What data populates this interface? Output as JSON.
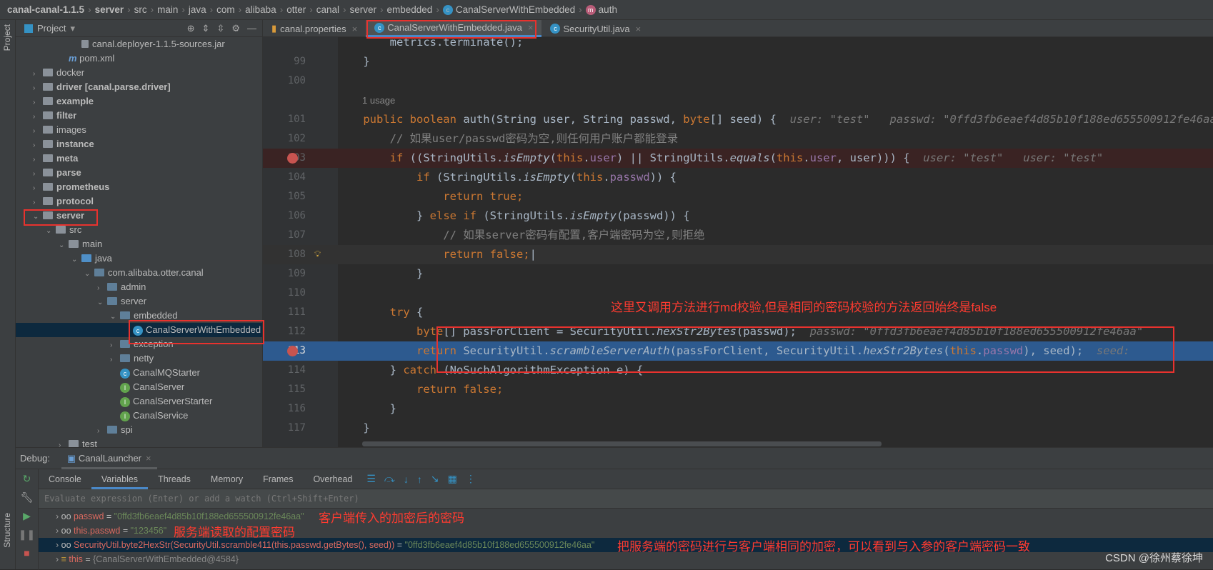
{
  "breadcrumb": [
    {
      "label": "canal-canal-1.1.5",
      "bold": true
    },
    {
      "label": "server",
      "bold": true
    },
    {
      "label": "src"
    },
    {
      "label": "main"
    },
    {
      "label": "java"
    },
    {
      "label": "com"
    },
    {
      "label": "alibaba"
    },
    {
      "label": "otter"
    },
    {
      "label": "canal"
    },
    {
      "label": "server"
    },
    {
      "label": "embedded"
    },
    {
      "label": "CanalServerWithEmbedded",
      "icon": "c"
    },
    {
      "label": "auth",
      "icon": "m"
    }
  ],
  "left_strip": {
    "project": "Project",
    "structure": "Structure"
  },
  "project_panel": {
    "title": "Project",
    "tree": [
      {
        "label": "canal.deployer-1.1.5-sources.jar",
        "depth": 4,
        "kind": "jar",
        "sel": false
      },
      {
        "label": "pom.xml",
        "depth": 3,
        "kind": "maven"
      },
      {
        "label": "docker",
        "depth": 1,
        "kind": "folder",
        "arrow": "›"
      },
      {
        "label": "driver [canal.parse.driver]",
        "depth": 1,
        "kind": "folder",
        "arrow": "›",
        "bold": true
      },
      {
        "label": "example",
        "depth": 1,
        "kind": "folder",
        "arrow": "›",
        "bold": true
      },
      {
        "label": "filter",
        "depth": 1,
        "kind": "folder",
        "arrow": "›",
        "bold": true
      },
      {
        "label": "images",
        "depth": 1,
        "kind": "folder",
        "arrow": "›"
      },
      {
        "label": "instance",
        "depth": 1,
        "kind": "folder",
        "arrow": "›",
        "bold": true
      },
      {
        "label": "meta",
        "depth": 1,
        "kind": "folder",
        "arrow": "›",
        "bold": true
      },
      {
        "label": "parse",
        "depth": 1,
        "kind": "folder",
        "arrow": "›",
        "bold": true
      },
      {
        "label": "prometheus",
        "depth": 1,
        "kind": "folder",
        "arrow": "›",
        "bold": true
      },
      {
        "label": "protocol",
        "depth": 1,
        "kind": "folder",
        "arrow": "›",
        "bold": true
      },
      {
        "label": "server",
        "depth": 1,
        "kind": "folder",
        "arrow": "⌄",
        "bold": true
      },
      {
        "label": "src",
        "depth": 2,
        "kind": "folder",
        "arrow": "⌄"
      },
      {
        "label": "main",
        "depth": 3,
        "kind": "folder",
        "arrow": "⌄"
      },
      {
        "label": "java",
        "depth": 4,
        "kind": "src",
        "arrow": "⌄"
      },
      {
        "label": "com.alibaba.otter.canal",
        "depth": 5,
        "kind": "pkg",
        "arrow": "⌄"
      },
      {
        "label": "admin",
        "depth": 6,
        "kind": "pkg",
        "arrow": "›"
      },
      {
        "label": "server",
        "depth": 6,
        "kind": "pkg",
        "arrow": "⌄"
      },
      {
        "label": "embedded",
        "depth": 7,
        "kind": "pkg",
        "arrow": "⌄"
      },
      {
        "label": "CanalServerWithEmbedded",
        "depth": 8,
        "kind": "class",
        "sel": true
      },
      {
        "label": "exception",
        "depth": 7,
        "kind": "pkg",
        "arrow": "›"
      },
      {
        "label": "netty",
        "depth": 7,
        "kind": "pkg",
        "arrow": "›"
      },
      {
        "label": "CanalMQStarter",
        "depth": 7,
        "kind": "class"
      },
      {
        "label": "CanalServer",
        "depth": 7,
        "kind": "interface"
      },
      {
        "label": "CanalServerStarter",
        "depth": 7,
        "kind": "interface"
      },
      {
        "label": "CanalService",
        "depth": 7,
        "kind": "interface"
      },
      {
        "label": "spi",
        "depth": 6,
        "kind": "pkg",
        "arrow": "›"
      },
      {
        "label": "test",
        "depth": 3,
        "kind": "folder",
        "arrow": "›"
      }
    ]
  },
  "tabs": [
    {
      "label": "canal.properties",
      "icon": "properties"
    },
    {
      "label": "CanalServerWithEmbedded.java",
      "icon": "c",
      "active": true
    },
    {
      "label": "SecurityUtil.java",
      "icon": "c"
    }
  ],
  "editor": {
    "usage": "1 usage",
    "lines": [
      {
        "n": "",
        "t": [
          [
            "",
            "        metrics.terminate();"
          ]
        ]
      },
      {
        "n": "99",
        "t": [
          [
            "",
            "    }"
          ]
        ]
      },
      {
        "n": "100",
        "t": []
      },
      {
        "n": "",
        "usage": true,
        "t": []
      },
      {
        "n": "101",
        "t": [
          [
            "kw",
            "    public boolean "
          ],
          [
            "",
            "auth(String user, String passwd, "
          ],
          [
            "kw",
            "byte"
          ],
          [
            "",
            "[] seed) {  "
          ],
          [
            "hint",
            "user: \"test\"   passwd: \"0ffd3fb6eaef4d85b10f188ed655500912fe46aa\""
          ]
        ]
      },
      {
        "n": "102",
        "t": [
          [
            "cm",
            "        // 如果user/passwd密码为空,则任何用户账户都能登录"
          ]
        ]
      },
      {
        "n": "103",
        "bp": true,
        "cls": "bp",
        "t": [
          [
            "kw",
            "        if "
          ],
          [
            "",
            "((StringUtils."
          ],
          [
            "it",
            "isEmpty"
          ],
          [
            "",
            "("
          ],
          [
            "kw",
            "this"
          ],
          [
            "",
            "."
          ],
          [
            "fld",
            "user"
          ],
          [
            "",
            ") || StringUtils."
          ],
          [
            "it",
            "equals"
          ],
          [
            "",
            "("
          ],
          [
            "kw",
            "this"
          ],
          [
            "",
            "."
          ],
          [
            "fld",
            "user"
          ],
          [
            "",
            ", user))) {  "
          ],
          [
            "hint",
            "user: \"test\"   user: \"test\""
          ]
        ]
      },
      {
        "n": "104",
        "t": [
          [
            "kw",
            "            if "
          ],
          [
            "",
            "(StringUtils."
          ],
          [
            "it",
            "isEmpty"
          ],
          [
            "",
            "("
          ],
          [
            "kw",
            "this"
          ],
          [
            "",
            "."
          ],
          [
            "fld",
            "passwd"
          ],
          [
            "",
            ")) {"
          ]
        ]
      },
      {
        "n": "105",
        "t": [
          [
            "kw",
            "                return true"
          ],
          [
            "kw",
            ";"
          ]
        ]
      },
      {
        "n": "106",
        "t": [
          [
            "",
            "            } "
          ],
          [
            "kw",
            "else if "
          ],
          [
            "",
            "(StringUtils."
          ],
          [
            "it",
            "isEmpty"
          ],
          [
            "",
            "(passwd)) {"
          ]
        ]
      },
      {
        "n": "107",
        "t": [
          [
            "cm",
            "                // 如果server密码有配置,客户端密码为空,则拒绝"
          ]
        ]
      },
      {
        "n": "108",
        "cls": "cur",
        "t": [
          [
            "kw",
            "                return false"
          ],
          [
            "kw",
            ";"
          ],
          [
            "",
            "|"
          ]
        ]
      },
      {
        "n": "109",
        "t": [
          [
            "",
            "            }"
          ]
        ]
      },
      {
        "n": "110",
        "t": []
      },
      {
        "n": "111",
        "t": [
          [
            "kw",
            "        try "
          ],
          [
            "",
            "{"
          ]
        ]
      },
      {
        "n": "112",
        "t": [
          [
            "kw",
            "            byte"
          ],
          [
            "",
            "[] passForClient = SecurityUtil."
          ],
          [
            "it",
            "hexStr2Bytes"
          ],
          [
            "",
            "(passwd);  "
          ],
          [
            "hint",
            "passwd: \"0ffd3fb6eaef4d85b10f188ed655500912fe46aa\""
          ]
        ]
      },
      {
        "n": "113",
        "bp": true,
        "cls": "exec",
        "t": [
          [
            "kw",
            "            return "
          ],
          [
            "",
            "SecurityUtil."
          ],
          [
            "it",
            "scrambleServerAuth"
          ],
          [
            "",
            "(passForClient, SecurityUtil."
          ],
          [
            "it",
            "hexStr2Bytes"
          ],
          [
            "",
            "("
          ],
          [
            "kw",
            "this"
          ],
          [
            "",
            "."
          ],
          [
            "fld",
            "passwd"
          ],
          [
            "",
            "), seed);  "
          ],
          [
            "hint",
            "seed: "
          ]
        ]
      },
      {
        "n": "114",
        "t": [
          [
            "",
            "        } "
          ],
          [
            "kw",
            "catch "
          ],
          [
            "",
            "(NoSuchAlgorithmException e) {"
          ]
        ]
      },
      {
        "n": "115",
        "t": [
          [
            "kw",
            "            return false"
          ],
          [
            "kw",
            ";"
          ]
        ]
      },
      {
        "n": "116",
        "t": [
          [
            "",
            "        }"
          ]
        ]
      },
      {
        "n": "117",
        "t": [
          [
            "",
            "    }"
          ]
        ]
      }
    ]
  },
  "debug": {
    "label": "Debug:",
    "session": "CanalLauncher",
    "tabs": [
      "Console",
      "Variables",
      "Threads",
      "Memory",
      "Frames",
      "Overhead"
    ],
    "active_tab": "Variables",
    "eval_placeholder": "Evaluate expression (Enter) or add a watch (Ctrl+Shift+Enter)",
    "variables": [
      {
        "name": "passwd",
        "value": "\"0ffd3fb6eaef4d85b10f188ed655500912fe46aa\"",
        "icon": "watch"
      },
      {
        "name": "this.passwd",
        "value": "\"123456\"",
        "icon": "watch"
      },
      {
        "name": "SecurityUtil.byte2HexStr(SecurityUtil.scramble411(this.passwd.getBytes(), seed))",
        "value": "\"0ffd3fb6eaef4d85b10f188ed655500912fe46aa\"",
        "icon": "watch",
        "sel": true
      },
      {
        "name": "this",
        "value": "{CanalServerWithEmbedded@4584}",
        "icon": "field",
        "obj": true
      }
    ]
  },
  "annotations": {
    "md_check": "这里又调用方法进行md校验,但是相同的密码校验的方法返回始终是false",
    "client_pwd": "客户端传入的加密后的密码",
    "server_pwd": "服务端读取的配置密码",
    "same_enc": "把服务端的密码进行与客户端相同的加密，可以看到与入参的客户端密码一致"
  },
  "watermark": "CSDN @徐州蔡徐坤",
  "colors": {
    "annotation": "#e8322e",
    "selection": "#2d5a8f",
    "accent": "#4a88c7"
  }
}
